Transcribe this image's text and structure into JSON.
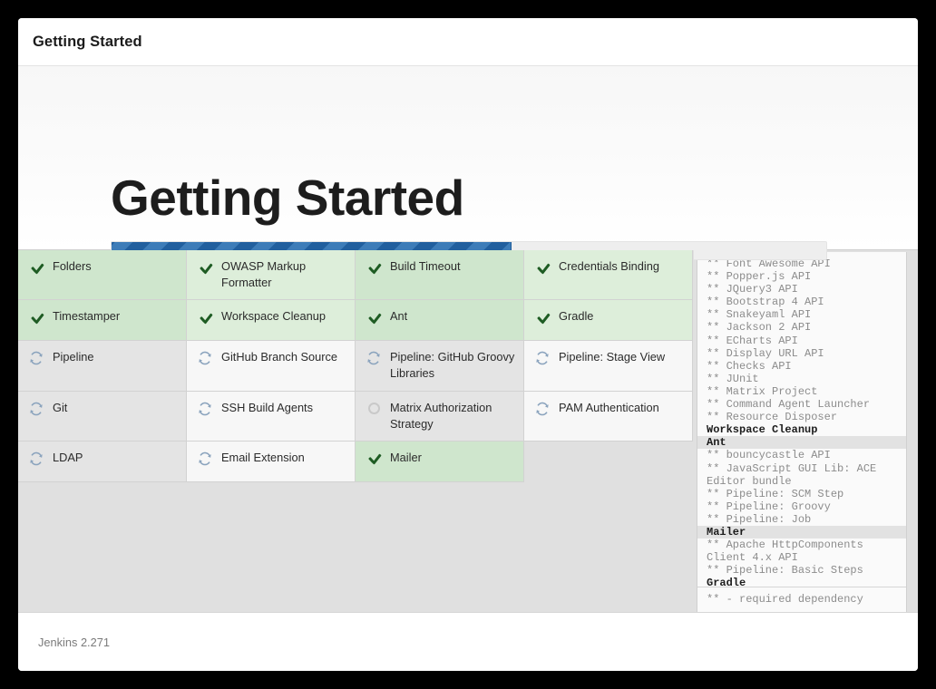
{
  "window": {
    "titlebar_text": "Getting Started"
  },
  "hero": {
    "heading": "Getting Started",
    "progress": {
      "percent": 56,
      "icon": "striped-progress-bar",
      "fill_color": "#2b6cb0",
      "track_color": "#eeeeee"
    }
  },
  "plugins": {
    "status_icons": {
      "done": "check-icon",
      "installing": "sync-spinner-icon",
      "pending": "empty-circle-icon"
    },
    "items": [
      {
        "name": "Folders",
        "status": "done",
        "col": 1
      },
      {
        "name": "OWASP Markup Formatter",
        "status": "done",
        "col": 2
      },
      {
        "name": "Build Timeout",
        "status": "done",
        "col": 3
      },
      {
        "name": "Credentials Binding",
        "status": "done",
        "col": 4
      },
      {
        "name": "Timestamper",
        "status": "done",
        "col": 1
      },
      {
        "name": "Workspace Cleanup",
        "status": "done",
        "col": 2
      },
      {
        "name": "Ant",
        "status": "done",
        "col": 3
      },
      {
        "name": "Gradle",
        "status": "done",
        "col": 4
      },
      {
        "name": "Pipeline",
        "status": "installing",
        "col": 1
      },
      {
        "name": "GitHub Branch Source",
        "status": "installing",
        "col": 2
      },
      {
        "name": "Pipeline: GitHub Groovy Libraries",
        "status": "installing",
        "col": 3
      },
      {
        "name": "Pipeline: Stage View",
        "status": "installing",
        "col": 4
      },
      {
        "name": "Git",
        "status": "installing",
        "col": 1
      },
      {
        "name": "SSH Build Agents",
        "status": "installing",
        "col": 2
      },
      {
        "name": "Matrix Authorization Strategy",
        "status": "pending",
        "col": 3
      },
      {
        "name": "PAM Authentication",
        "status": "installing",
        "col": 4
      },
      {
        "name": "LDAP",
        "status": "installing",
        "col": 1
      },
      {
        "name": "Email Extension",
        "status": "installing",
        "col": 2
      },
      {
        "name": "Mailer",
        "status": "done",
        "col": 3
      },
      {
        "name": "",
        "status": "empty",
        "col": 4
      }
    ]
  },
  "log": {
    "lines": [
      {
        "text": "** Font Awesome API",
        "type": "dep"
      },
      {
        "text": "** Popper.js API",
        "type": "dep"
      },
      {
        "text": "** JQuery3 API",
        "type": "dep"
      },
      {
        "text": "** Bootstrap 4 API",
        "type": "dep"
      },
      {
        "text": "** Snakeyaml API",
        "type": "dep"
      },
      {
        "text": "** Jackson 2 API",
        "type": "dep"
      },
      {
        "text": "** ECharts API",
        "type": "dep"
      },
      {
        "text": "** Display URL API",
        "type": "dep"
      },
      {
        "text": "** Checks API",
        "type": "dep"
      },
      {
        "text": "** JUnit",
        "type": "dep"
      },
      {
        "text": "** Matrix Project",
        "type": "dep"
      },
      {
        "text": "** Command Agent Launcher",
        "type": "dep"
      },
      {
        "text": "** Resource Disposer",
        "type": "dep"
      },
      {
        "text": "Workspace Cleanup",
        "type": "head"
      },
      {
        "text": "Ant",
        "type": "head-hl"
      },
      {
        "text": "** bouncycastle API",
        "type": "dep"
      },
      {
        "text": "** JavaScript GUI Lib: ACE Editor bundle",
        "type": "dep"
      },
      {
        "text": "** Pipeline: SCM Step",
        "type": "dep"
      },
      {
        "text": "** Pipeline: Groovy",
        "type": "dep"
      },
      {
        "text": "** Pipeline: Job",
        "type": "dep"
      },
      {
        "text": "Mailer",
        "type": "head-hl"
      },
      {
        "text": "** Apache HttpComponents Client 4.x API",
        "type": "dep"
      },
      {
        "text": "** Pipeline: Basic Steps",
        "type": "dep"
      },
      {
        "text": "Gradle",
        "type": "head"
      }
    ],
    "legend": "** - required dependency"
  },
  "footer": {
    "version": "Jenkins 2.271"
  }
}
